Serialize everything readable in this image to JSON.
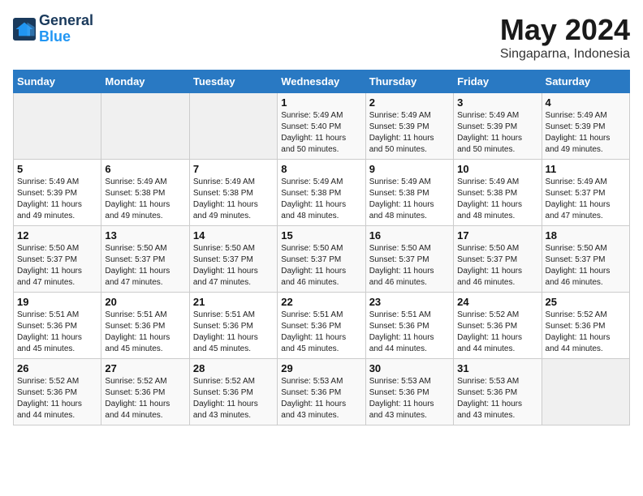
{
  "logo": {
    "line1": "General",
    "line2": "Blue"
  },
  "title": "May 2024",
  "subtitle": "Singaparna, Indonesia",
  "weekdays": [
    "Sunday",
    "Monday",
    "Tuesday",
    "Wednesday",
    "Thursday",
    "Friday",
    "Saturday"
  ],
  "weeks": [
    [
      {
        "day": "",
        "info": ""
      },
      {
        "day": "",
        "info": ""
      },
      {
        "day": "",
        "info": ""
      },
      {
        "day": "1",
        "info": "Sunrise: 5:49 AM\nSunset: 5:40 PM\nDaylight: 11 hours\nand 50 minutes."
      },
      {
        "day": "2",
        "info": "Sunrise: 5:49 AM\nSunset: 5:39 PM\nDaylight: 11 hours\nand 50 minutes."
      },
      {
        "day": "3",
        "info": "Sunrise: 5:49 AM\nSunset: 5:39 PM\nDaylight: 11 hours\nand 50 minutes."
      },
      {
        "day": "4",
        "info": "Sunrise: 5:49 AM\nSunset: 5:39 PM\nDaylight: 11 hours\nand 49 minutes."
      }
    ],
    [
      {
        "day": "5",
        "info": "Sunrise: 5:49 AM\nSunset: 5:39 PM\nDaylight: 11 hours\nand 49 minutes."
      },
      {
        "day": "6",
        "info": "Sunrise: 5:49 AM\nSunset: 5:38 PM\nDaylight: 11 hours\nand 49 minutes."
      },
      {
        "day": "7",
        "info": "Sunrise: 5:49 AM\nSunset: 5:38 PM\nDaylight: 11 hours\nand 49 minutes."
      },
      {
        "day": "8",
        "info": "Sunrise: 5:49 AM\nSunset: 5:38 PM\nDaylight: 11 hours\nand 48 minutes."
      },
      {
        "day": "9",
        "info": "Sunrise: 5:49 AM\nSunset: 5:38 PM\nDaylight: 11 hours\nand 48 minutes."
      },
      {
        "day": "10",
        "info": "Sunrise: 5:49 AM\nSunset: 5:38 PM\nDaylight: 11 hours\nand 48 minutes."
      },
      {
        "day": "11",
        "info": "Sunrise: 5:49 AM\nSunset: 5:37 PM\nDaylight: 11 hours\nand 47 minutes."
      }
    ],
    [
      {
        "day": "12",
        "info": "Sunrise: 5:50 AM\nSunset: 5:37 PM\nDaylight: 11 hours\nand 47 minutes."
      },
      {
        "day": "13",
        "info": "Sunrise: 5:50 AM\nSunset: 5:37 PM\nDaylight: 11 hours\nand 47 minutes."
      },
      {
        "day": "14",
        "info": "Sunrise: 5:50 AM\nSunset: 5:37 PM\nDaylight: 11 hours\nand 47 minutes."
      },
      {
        "day": "15",
        "info": "Sunrise: 5:50 AM\nSunset: 5:37 PM\nDaylight: 11 hours\nand 46 minutes."
      },
      {
        "day": "16",
        "info": "Sunrise: 5:50 AM\nSunset: 5:37 PM\nDaylight: 11 hours\nand 46 minutes."
      },
      {
        "day": "17",
        "info": "Sunrise: 5:50 AM\nSunset: 5:37 PM\nDaylight: 11 hours\nand 46 minutes."
      },
      {
        "day": "18",
        "info": "Sunrise: 5:50 AM\nSunset: 5:37 PM\nDaylight: 11 hours\nand 46 minutes."
      }
    ],
    [
      {
        "day": "19",
        "info": "Sunrise: 5:51 AM\nSunset: 5:36 PM\nDaylight: 11 hours\nand 45 minutes."
      },
      {
        "day": "20",
        "info": "Sunrise: 5:51 AM\nSunset: 5:36 PM\nDaylight: 11 hours\nand 45 minutes."
      },
      {
        "day": "21",
        "info": "Sunrise: 5:51 AM\nSunset: 5:36 PM\nDaylight: 11 hours\nand 45 minutes."
      },
      {
        "day": "22",
        "info": "Sunrise: 5:51 AM\nSunset: 5:36 PM\nDaylight: 11 hours\nand 45 minutes."
      },
      {
        "day": "23",
        "info": "Sunrise: 5:51 AM\nSunset: 5:36 PM\nDaylight: 11 hours\nand 44 minutes."
      },
      {
        "day": "24",
        "info": "Sunrise: 5:52 AM\nSunset: 5:36 PM\nDaylight: 11 hours\nand 44 minutes."
      },
      {
        "day": "25",
        "info": "Sunrise: 5:52 AM\nSunset: 5:36 PM\nDaylight: 11 hours\nand 44 minutes."
      }
    ],
    [
      {
        "day": "26",
        "info": "Sunrise: 5:52 AM\nSunset: 5:36 PM\nDaylight: 11 hours\nand 44 minutes."
      },
      {
        "day": "27",
        "info": "Sunrise: 5:52 AM\nSunset: 5:36 PM\nDaylight: 11 hours\nand 44 minutes."
      },
      {
        "day": "28",
        "info": "Sunrise: 5:52 AM\nSunset: 5:36 PM\nDaylight: 11 hours\nand 43 minutes."
      },
      {
        "day": "29",
        "info": "Sunrise: 5:53 AM\nSunset: 5:36 PM\nDaylight: 11 hours\nand 43 minutes."
      },
      {
        "day": "30",
        "info": "Sunrise: 5:53 AM\nSunset: 5:36 PM\nDaylight: 11 hours\nand 43 minutes."
      },
      {
        "day": "31",
        "info": "Sunrise: 5:53 AM\nSunset: 5:36 PM\nDaylight: 11 hours\nand 43 minutes."
      },
      {
        "day": "",
        "info": ""
      }
    ]
  ]
}
